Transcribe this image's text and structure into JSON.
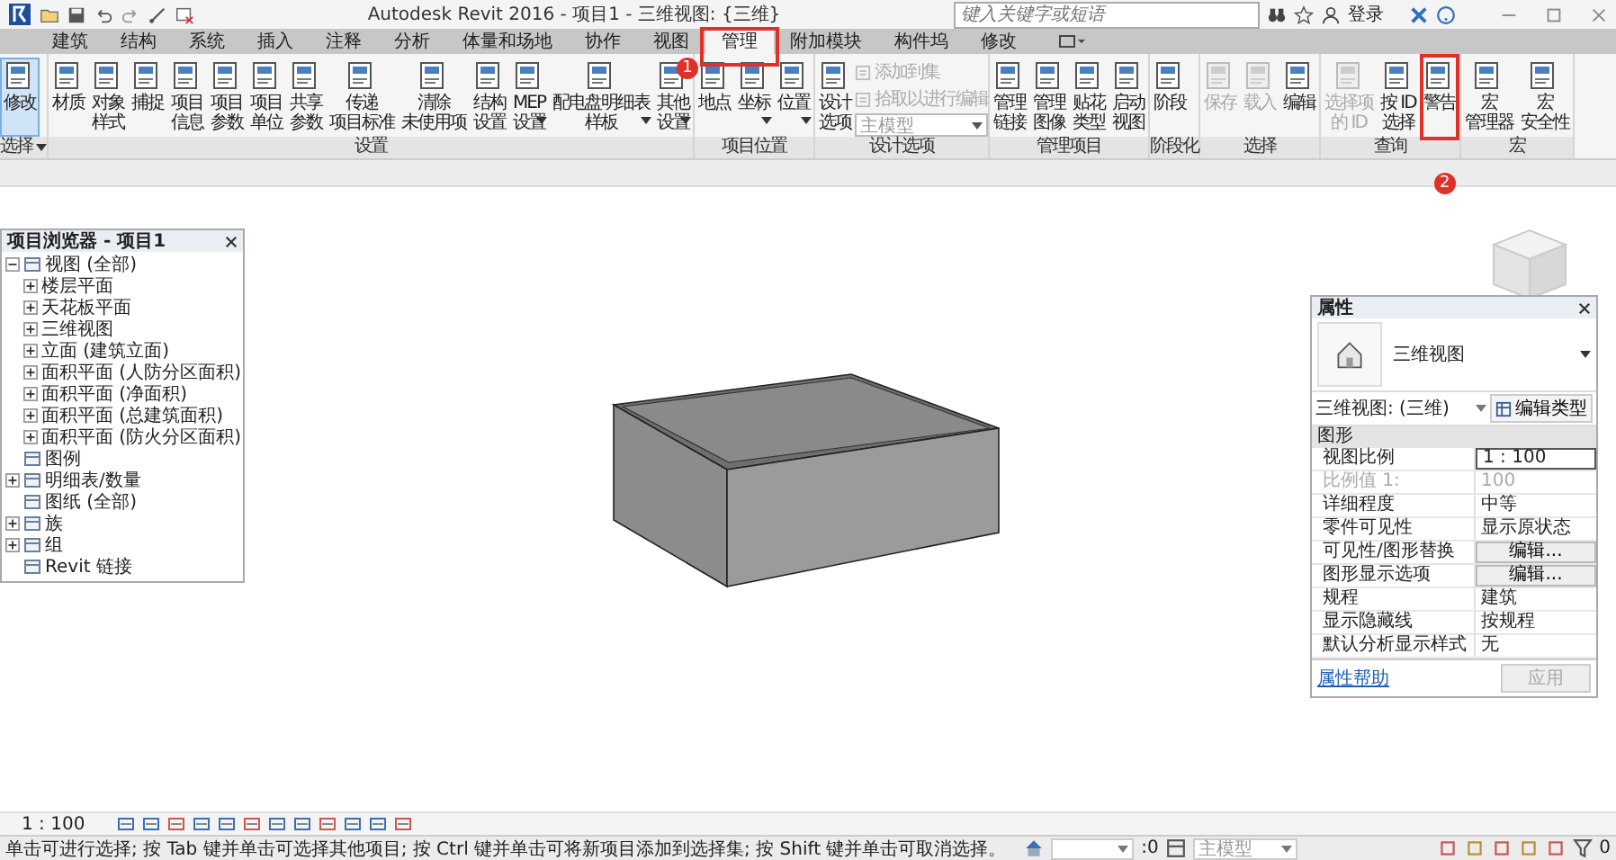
{
  "title_bar": {
    "title": "Autodesk Revit 2016 -   项目1 - 三维视图: {三维}",
    "search": {
      "placeholder": "键入关键字或短语"
    },
    "sign_in": "登录"
  },
  "tabs": [
    {
      "label": "建筑",
      "selected": false
    },
    {
      "label": "结构",
      "selected": false
    },
    {
      "label": "系统",
      "selected": false
    },
    {
      "label": "插入",
      "selected": false
    },
    {
      "label": "注释",
      "selected": false
    },
    {
      "label": "分析",
      "selected": false
    },
    {
      "label": "体量和场地",
      "selected": false
    },
    {
      "label": "协作",
      "selected": false
    },
    {
      "label": "视图",
      "selected": false
    },
    {
      "label": "管理",
      "selected": true,
      "callout": "1"
    },
    {
      "label": "附加模块",
      "selected": false
    },
    {
      "label": "构件坞",
      "selected": false
    },
    {
      "label": "修改",
      "selected": false
    }
  ],
  "ribbon": {
    "panels": [
      {
        "label": "选择",
        "menu": true,
        "buttons": [
          {
            "lines": [
              "修改"
            ],
            "selected": true
          }
        ]
      },
      {
        "label": "设置",
        "buttons": [
          {
            "lines": [
              "材质"
            ]
          },
          {
            "lines": [
              "对象",
              "样式"
            ]
          },
          {
            "lines": [
              "捕捉"
            ]
          },
          {
            "lines": [
              "项目",
              "信息"
            ]
          },
          {
            "lines": [
              "项目",
              "参数"
            ]
          },
          {
            "lines": [
              "项目",
              "单位"
            ]
          },
          {
            "lines": [
              "共享",
              "参数"
            ]
          },
          {
            "lines": [
              "传递",
              "项目标准"
            ]
          },
          {
            "lines": [
              "清除",
              "未使用项"
            ]
          },
          {
            "lines": [
              "结构",
              "设置"
            ]
          },
          {
            "lines": [
              "MEP",
              "设置"
            ],
            "dropdown": true
          },
          {
            "lines": [
              "配电盘明细表",
              "样板"
            ],
            "dropdown": true
          },
          {
            "lines": [
              "其他",
              "设置"
            ],
            "dropdown": true
          }
        ]
      },
      {
        "label": "项目位置",
        "buttons": [
          {
            "lines": [
              "地点"
            ]
          },
          {
            "lines": [
              "坐标"
            ],
            "dropdown": true
          },
          {
            "lines": [
              "位置"
            ],
            "dropdown": true
          }
        ]
      },
      {
        "label": "设计选项",
        "buttons": [
          {
            "lines": [
              "设计",
              "选项"
            ]
          }
        ],
        "small_items": [
          {
            "label": "添加到集",
            "disabled": true
          },
          {
            "label": "拾取以进行编辑",
            "disabled": true
          }
        ],
        "select": {
          "value": "主模型"
        }
      },
      {
        "label": "管理项目",
        "buttons": [
          {
            "lines": [
              "管理",
              "链接"
            ]
          },
          {
            "lines": [
              "管理",
              "图像"
            ]
          },
          {
            "lines": [
              "贴花",
              "类型"
            ]
          },
          {
            "lines": [
              "启动",
              "视图"
            ]
          }
        ]
      },
      {
        "label": "阶段化",
        "buttons": [
          {
            "lines": [
              "阶段"
            ]
          }
        ]
      },
      {
        "label": "选择",
        "buttons": [
          {
            "lines": [
              "保存"
            ],
            "disabled": true
          },
          {
            "lines": [
              "载入"
            ],
            "disabled": true
          },
          {
            "lines": [
              "编辑"
            ]
          }
        ]
      },
      {
        "label": "查询",
        "buttons": [
          {
            "lines": [
              "选择项",
              "的 ID"
            ],
            "disabled": true
          },
          {
            "lines": [
              "按 ID",
              "选择"
            ]
          },
          {
            "lines": [
              "警告"
            ],
            "callout": "2"
          }
        ]
      },
      {
        "label": "宏",
        "buttons": [
          {
            "lines": [
              "宏",
              "管理器"
            ]
          },
          {
            "lines": [
              "宏",
              "安全性"
            ]
          }
        ]
      }
    ]
  },
  "project_browser": {
    "title": "项目浏览器 - 项目1",
    "items": [
      {
        "label": "视图 (全部)",
        "expanded": true,
        "children": [
          {
            "label": "楼层平面",
            "expanded": false
          },
          {
            "label": "天花板平面",
            "expanded": false
          },
          {
            "label": "三维视图",
            "expanded": false
          },
          {
            "label": "立面 (建筑立面)",
            "expanded": false
          },
          {
            "label": "面积平面 (人防分区面积)",
            "expanded": false
          },
          {
            "label": "面积平面 (净面积)",
            "expanded": false
          },
          {
            "label": "面积平面 (总建筑面积)",
            "expanded": false
          },
          {
            "label": "面积平面 (防火分区面积)",
            "expanded": false
          }
        ]
      },
      {
        "label": "图例"
      },
      {
        "label": "明细表/数量",
        "expanded": false
      },
      {
        "label": "图纸 (全部)"
      },
      {
        "label": "族",
        "expanded": false
      },
      {
        "label": "组",
        "expanded": false
      },
      {
        "label": "Revit 链接"
      }
    ]
  },
  "properties": {
    "title": "属性",
    "type_name": "三维视图",
    "selector": "三维视图: (三维)",
    "edit_type": "编辑类型",
    "group": "图形",
    "rows": [
      {
        "label": "视图比例",
        "value": "1 : 100",
        "kind": "field"
      },
      {
        "label": "比例值 1:",
        "value": "100",
        "kind": "value",
        "disabled": true
      },
      {
        "label": "详细程度",
        "value": "中等",
        "kind": "value"
      },
      {
        "label": "零件可见性",
        "value": "显示原状态",
        "kind": "value"
      },
      {
        "label": "可见性/图形替换",
        "value": "编辑...",
        "kind": "button"
      },
      {
        "label": "图形显示选项",
        "value": "编辑...",
        "kind": "button"
      },
      {
        "label": "规程",
        "value": "建筑",
        "kind": "value"
      },
      {
        "label": "显示隐藏线",
        "value": "按规程",
        "kind": "value"
      },
      {
        "label": "默认分析显示样式",
        "value": "无",
        "kind": "value"
      }
    ],
    "help_link": "属性帮助",
    "apply": {
      "label": "应用",
      "disabled": true
    }
  },
  "view_bar": {
    "scale": "1 : 100"
  },
  "status_bar": {
    "message": "单击可进行选择; 按 Tab 键并单击可选择其他项目; 按 Ctrl 键并单击可将新项目添加到选择集; 按 Shift 键并单击可取消选择。",
    "editable_count": ":0",
    "design_option": "主模型",
    "filter_count": "0"
  }
}
